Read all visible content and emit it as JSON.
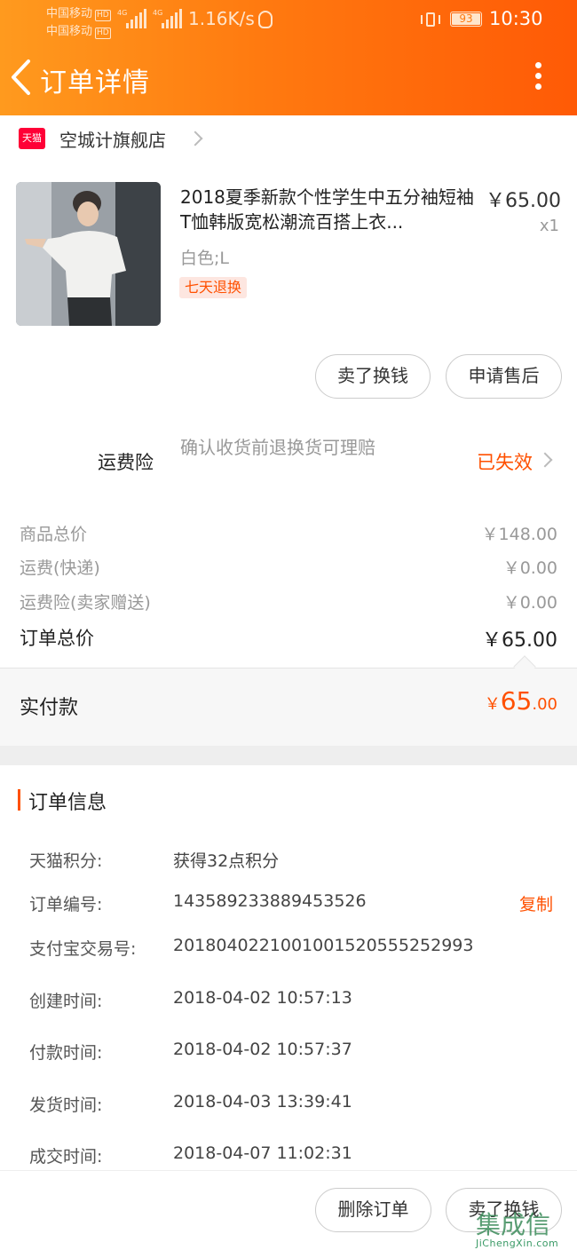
{
  "status_bar": {
    "carrier1": "中国移动",
    "carrier2": "中国移动",
    "hd": "HD",
    "net_type": "4G",
    "net_speed": "1.16K/s",
    "battery": "93",
    "time": "10:30"
  },
  "header": {
    "title": "订单详情",
    "back_icon": "chevron-left-icon",
    "more_icon": "more-vertical-icon"
  },
  "shop": {
    "badge": "天猫",
    "name": "空城计旗舰店"
  },
  "product": {
    "title": "2018夏季新款个性学生中五分袖短袖T恤韩版宽松潮流百搭上衣...",
    "price": "￥65.00",
    "quantity": "x1",
    "sku": "白色;L",
    "tag": "七天退换"
  },
  "actions": {
    "sell_label": "卖了换钱",
    "aftersale_label": "申请售后"
  },
  "insurance": {
    "label": "运费险",
    "desc": "确认收货前退换货可理赔",
    "status": "已失效"
  },
  "costs": [
    {
      "label": "商品总价",
      "value": "￥148.00"
    },
    {
      "label": "运费(快递)",
      "value": "￥0.00"
    },
    {
      "label": "运费险(卖家赠送)",
      "value": "￥0.00"
    }
  ],
  "order_total": {
    "label": "订单总价",
    "value": "￥65.00"
  },
  "paid": {
    "label": "实付款",
    "currency": "￥",
    "integer": "65",
    "decimal": ".00"
  },
  "order_info": {
    "title": "订单信息",
    "copy_label": "复制",
    "rows": [
      {
        "key": "天猫积分:",
        "value": "获得32点积分"
      },
      {
        "key": "订单编号:",
        "value": "143589233889453526"
      },
      {
        "key": "支付宝交易号:",
        "value": "2018040221001001520555252993"
      },
      {
        "key": "创建时间:",
        "value": "2018-04-02 10:57:13"
      },
      {
        "key": "付款时间:",
        "value": "2018-04-02 10:57:37"
      },
      {
        "key": "发货时间:",
        "value": "2018-04-03 13:39:41"
      },
      {
        "key": "成交时间:",
        "value": "2018-04-07 11:02:31"
      }
    ]
  },
  "bottom_actions": {
    "delete_label": "删除订单",
    "sell_label": "卖了换钱"
  },
  "watermark": {
    "text": "集成信",
    "url": "JiChengXin.com"
  },
  "colors": {
    "accent": "#ff5000",
    "header_start": "#ff9a1e",
    "header_end": "#ff5a06",
    "tmall_red": "#ff0036"
  }
}
